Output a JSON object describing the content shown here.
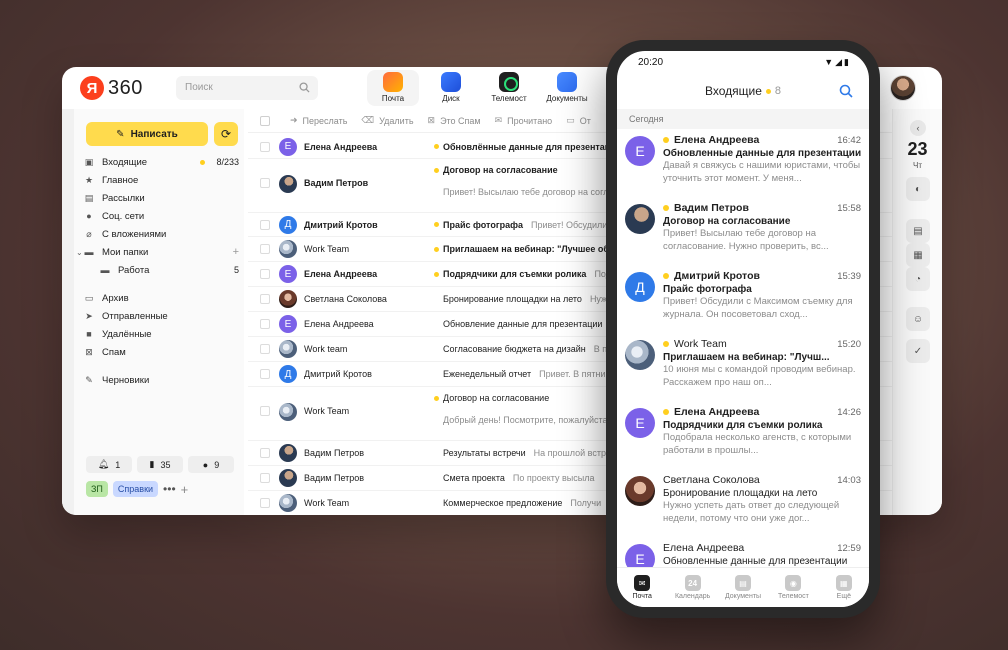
{
  "brand": {
    "badge": "Я",
    "name": "360"
  },
  "search": {
    "placeholder": "Поиск"
  },
  "apps": [
    {
      "label": "Почта",
      "icon": "mail-icon"
    },
    {
      "label": "Диск",
      "icon": "disk-icon"
    },
    {
      "label": "Телемост",
      "icon": "telemost-icon"
    },
    {
      "label": "Документы",
      "icon": "docs-icon"
    }
  ],
  "sidebar": {
    "compose": "Написать",
    "folders": [
      {
        "label": "Входящие",
        "count": "8/233"
      },
      {
        "label": "Главное"
      },
      {
        "label": "Рассылки"
      },
      {
        "label": "Соц. сети"
      },
      {
        "label": "С вложениями"
      },
      {
        "label": "Мои папки"
      },
      {
        "label": "Работа",
        "count": "5"
      },
      {
        "label": "Архив"
      },
      {
        "label": "Отправленные"
      },
      {
        "label": "Удалённые"
      },
      {
        "label": "Спам"
      },
      {
        "label": "Черновики"
      }
    ],
    "counters": [
      "1",
      "35",
      "9"
    ],
    "tags": [
      "ЗП",
      "Справки"
    ]
  },
  "toolbar": {
    "forward": "Переслать",
    "delete": "Удалить",
    "spam": "Это Спам",
    "read": "Прочитано",
    "more": "От"
  },
  "mail_rows": [
    {
      "from": "Елена Андреева",
      "subject": "Обновлённые данные для презентации",
      "snippet": ""
    },
    {
      "from": "Вадим Петров",
      "subject": "Договор на согласование",
      "snippet": "Привет! Высылаю тебе договор на согла"
    },
    {
      "from": "Дмитрий Кротов",
      "subject": "Прайс фотографа",
      "snippet": "Привет! Обсудили с"
    },
    {
      "from": "Work Team",
      "subject": "Приглашаем на вебинар: \"Лучшее обра",
      "snippet": ""
    },
    {
      "from": "Елена Андреева",
      "subject": "Подрядчики для съемки ролика",
      "snippet": "Подо"
    },
    {
      "from": "Светлана Соколова",
      "subject": "Бронирование площадки на лето",
      "snippet": "Нужн"
    },
    {
      "from": "Елена Андреева",
      "subject": "Обновление данные для презентации",
      "snippet": "Да"
    },
    {
      "from": "Work team",
      "subject": "Согласование бюджета на дизайн",
      "snippet": "В пр"
    },
    {
      "from": "Дмитрий Кротов",
      "subject": "Еженедельный отчет",
      "snippet": "Привет. В пятниц"
    },
    {
      "from": "Work Team",
      "subject": "Договор на согласование",
      "snippet": "Добрый день! Посмотрите, пожалуйста,"
    },
    {
      "from": "Вадим Петров",
      "subject": "Результаты встречи",
      "snippet": "На прошлой встре"
    },
    {
      "from": "Вадим Петров",
      "subject": "Смета проекта",
      "snippet": "По проекту высыла"
    },
    {
      "from": "Work Team",
      "subject": "Коммерческое предложение",
      "snippet": "Получи"
    }
  ],
  "rail": {
    "day": "23",
    "dow": "Чт"
  },
  "phone": {
    "time": "20:20",
    "title": "Входящие",
    "count": "8",
    "section": "Сегодня",
    "items": [
      {
        "from": "Елена Андреева",
        "time": "16:42",
        "subject": "Обновленные данные для презентации",
        "snippet": "Давай я свяжусь с нашими юристами, чтобы уточнить этот момент. У меня...",
        "initial": "Е"
      },
      {
        "from": "Вадим Петров",
        "time": "15:58",
        "subject": "Договор на согласование",
        "snippet": "Привет! Высылаю тебе договор на согласование. Нужно проверить, вс...",
        "initial": ""
      },
      {
        "from": "Дмитрий Кротов",
        "time": "15:39",
        "subject": "Прайс фотографа",
        "snippet": "Привет! Обсудили с Максимом съемку для журнала. Он посоветовал сход...",
        "initial": "Д"
      },
      {
        "from": "Work Team",
        "time": "15:20",
        "subject": "Приглашаем на вебинар: \"Лучш...",
        "snippet": "10 июня мы с командой проводим вебинар. Расскажем про наш оп...",
        "initial": ""
      },
      {
        "from": "Елена Андреева",
        "time": "14:26",
        "subject": "Подрядчики для съемки ролика",
        "snippet": "Подобрала несколько агенств, с которыми работали в прошлы...",
        "initial": "Е"
      },
      {
        "from": "Светлана Соколова",
        "time": "14:03",
        "subject": "Бронирование площадки на лето",
        "snippet": "Нужно успеть дать ответ до следующей недели, потому что они уже дог...",
        "initial": ""
      },
      {
        "from": "Елена Андреева",
        "time": "12:59",
        "subject": "Обновленные данные для презентации",
        "snippet": "",
        "initial": "Е"
      }
    ],
    "nav": [
      {
        "label": "Почта"
      },
      {
        "label": "Календарь",
        "badge": "24"
      },
      {
        "label": "Документы"
      },
      {
        "label": "Телемост"
      },
      {
        "label": "Ещё"
      }
    ]
  },
  "colors": {
    "accent": "#ffdb4d",
    "unread_dot": "#ffcf1f",
    "avatar_purple": "#7b61e8",
    "avatar_blue": "#2f7ae8",
    "link_blue": "#2f7ae8"
  }
}
